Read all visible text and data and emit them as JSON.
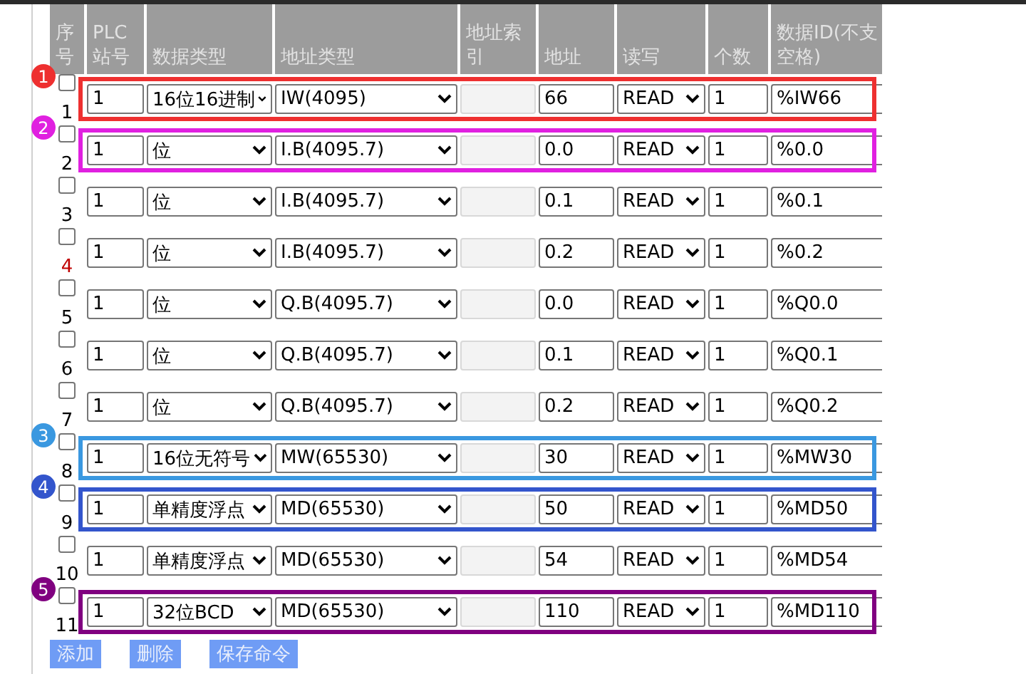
{
  "columns": [
    [
      "序",
      "号"
    ],
    [
      "PLC",
      "站号"
    ],
    [
      "数据类型"
    ],
    [
      "地址类型"
    ],
    [
      "地址索",
      "引"
    ],
    [
      "地址"
    ],
    [
      "读写"
    ],
    [
      "个数"
    ],
    [
      "数据ID(不支",
      "空格)"
    ]
  ],
  "rows": [
    {
      "checked": false,
      "number": "1",
      "color": "#000000",
      "station": "1",
      "data_type": "16位16进制",
      "address_type": "IW(4095)",
      "index_disabled": true,
      "address": "66",
      "rw": "READ",
      "count": "1",
      "data_id": "%IW66",
      "callout": {
        "label": "1",
        "color": "#ee3030"
      }
    },
    {
      "checked": false,
      "number": "2",
      "color": "#000000",
      "station": "1",
      "data_type": "位",
      "address_type": "I.B(4095.7)",
      "index_disabled": true,
      "address": "0.0",
      "rw": "READ",
      "count": "1",
      "data_id": "%0.0",
      "callout": {
        "label": "2",
        "color": "#e020e0"
      }
    },
    {
      "checked": false,
      "number": "3",
      "color": "#000000",
      "station": "1",
      "data_type": "位",
      "address_type": "I.B(4095.7)",
      "index_disabled": true,
      "address": "0.1",
      "rw": "READ",
      "count": "1",
      "data_id": "%0.1"
    },
    {
      "checked": false,
      "number": "4",
      "color": "#c00000",
      "station": "1",
      "data_type": "位",
      "address_type": "I.B(4095.7)",
      "index_disabled": true,
      "address": "0.2",
      "rw": "READ",
      "count": "1",
      "data_id": "%0.2"
    },
    {
      "checked": false,
      "number": "5",
      "color": "#000000",
      "station": "1",
      "data_type": "位",
      "address_type": "Q.B(4095.7)",
      "index_disabled": true,
      "address": "0.0",
      "rw": "READ",
      "count": "1",
      "data_id": "%Q0.0"
    },
    {
      "checked": false,
      "number": "6",
      "color": "#000000",
      "station": "1",
      "data_type": "位",
      "address_type": "Q.B(4095.7)",
      "index_disabled": true,
      "address": "0.1",
      "rw": "READ",
      "count": "1",
      "data_id": "%Q0.1"
    },
    {
      "checked": false,
      "number": "7",
      "color": "#000000",
      "station": "1",
      "data_type": "位",
      "address_type": "Q.B(4095.7)",
      "index_disabled": true,
      "address": "0.2",
      "rw": "READ",
      "count": "1",
      "data_id": "%Q0.2"
    },
    {
      "checked": false,
      "number": "8",
      "color": "#000000",
      "station": "1",
      "data_type": "16位无符号",
      "address_type": "MW(65530)",
      "index_disabled": true,
      "address": "30",
      "rw": "READ",
      "count": "1",
      "data_id": "%MW30",
      "callout": {
        "label": "3",
        "color": "#3a98e0"
      }
    },
    {
      "checked": false,
      "number": "9",
      "color": "#000000",
      "station": "1",
      "data_type": "单精度浮点",
      "address_type": "MD(65530)",
      "index_disabled": true,
      "address": "50",
      "rw": "READ",
      "count": "1",
      "data_id": "%MD50",
      "callout": {
        "label": "4",
        "color": "#3355cc"
      }
    },
    {
      "checked": false,
      "number": "10",
      "color": "#000000",
      "station": "1",
      "data_type": "单精度浮点",
      "address_type": "MD(65530)",
      "index_disabled": true,
      "address": "54",
      "rw": "READ",
      "count": "1",
      "data_id": "%MD54"
    },
    {
      "checked": false,
      "number": "11",
      "color": "#000000",
      "station": "1",
      "data_type": "32位BCD",
      "address_type": "MD(65530)",
      "index_disabled": true,
      "address": "110",
      "rw": "READ",
      "count": "1",
      "data_id": "%MD110",
      "callout": {
        "label": "5",
        "color": "#800080"
      }
    }
  ],
  "buttons": [
    "添加",
    "删除",
    "保存命令"
  ]
}
